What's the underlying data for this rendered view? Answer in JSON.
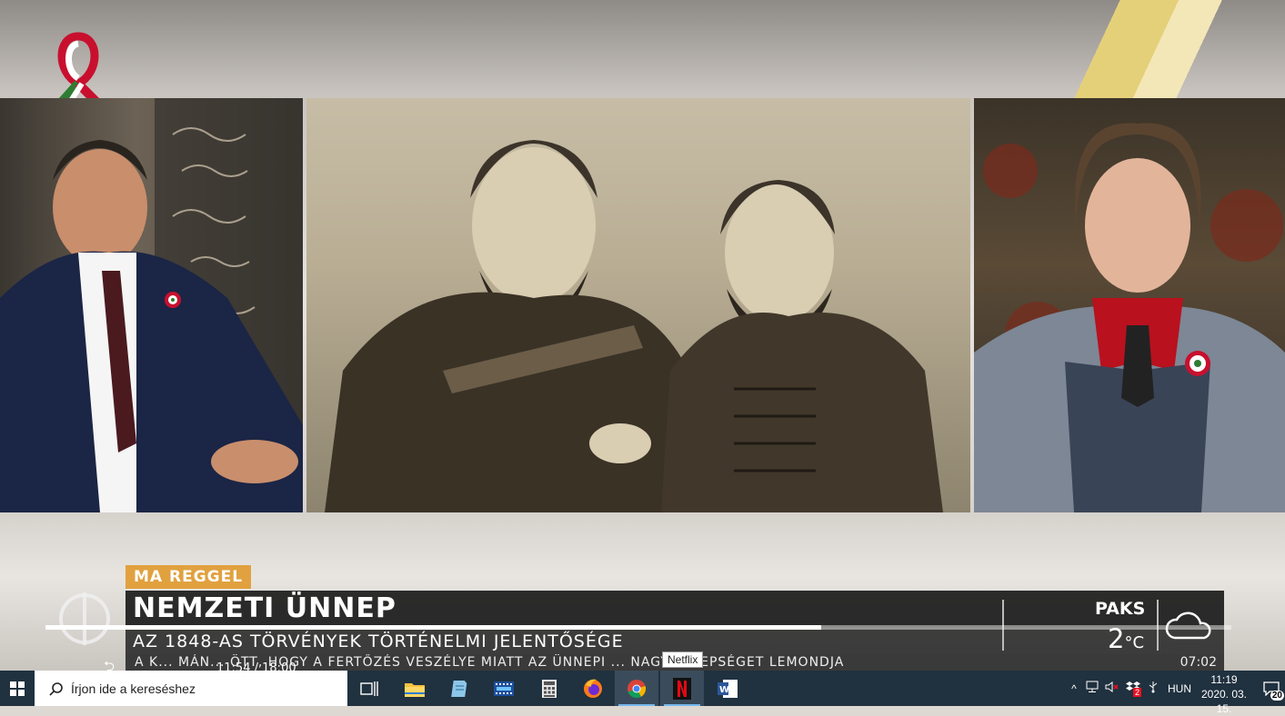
{
  "broadcast": {
    "tag": "MA REGGEL",
    "headline": "NEMZETI ÜNNEP",
    "subheadline": "AZ 1848-AS TÖRVÉNYEK TÖRTÉNELMI JELENTŐSÉGE",
    "ticker": "A K... MÁN... ÖTT, HOGY A FERTŐZÉS VESZÉLYE MIATT AZ ÜNNEPI ... NAGYÜNNEPSÉGET LEMONDJA",
    "ticker_time": "07:02",
    "weather": {
      "city": "PAKS",
      "temperature": "2",
      "unit": "°C"
    },
    "channel": "M1"
  },
  "player": {
    "timecode_current": "11:54",
    "timecode_separator": "/",
    "timecode_total": "18:00",
    "progress": 0.654,
    "tooltip": "Netflix"
  },
  "taskbar": {
    "search_placeholder": "Írjon ide a kereséshez",
    "apps": [
      {
        "name": "task-view",
        "active": false
      },
      {
        "name": "file-explorer",
        "active": false
      },
      {
        "name": "notepad",
        "active": false
      },
      {
        "name": "movie-maker",
        "active": false
      },
      {
        "name": "calculator",
        "active": false
      },
      {
        "name": "firefox",
        "active": false
      },
      {
        "name": "chrome",
        "active": true
      },
      {
        "name": "netflix",
        "active": true
      },
      {
        "name": "word",
        "active": false
      }
    ],
    "tray": {
      "language": "HUN",
      "badge": "2"
    },
    "clock": {
      "time": "11:19",
      "date": "2020. 03. 15."
    },
    "notification_count": "20"
  },
  "colors": {
    "taskbar": "#20313f",
    "tag": "#e1a13f",
    "accent": "#76b9ed"
  }
}
